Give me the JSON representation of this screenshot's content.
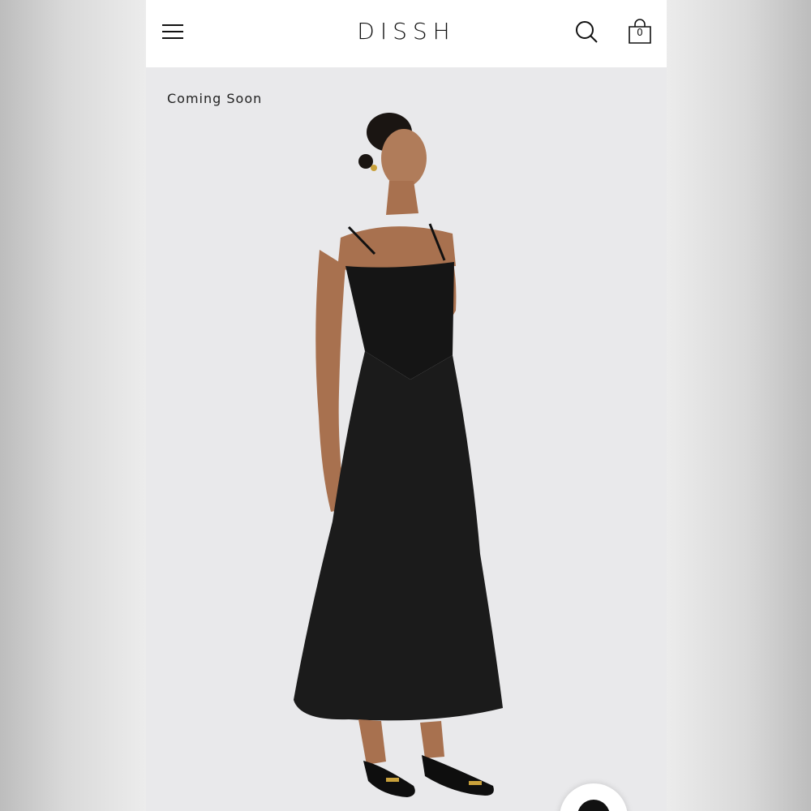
{
  "header": {
    "brand": "DISSH",
    "menu_icon": "hamburger-menu-icon",
    "search_icon": "search-icon",
    "cart_icon": "shopping-bag-icon",
    "cart_count": "0"
  },
  "product": {
    "badge": "Coming Soon",
    "image": "model-wearing-black-midi-dress"
  },
  "colors": {
    "header_bg": "#ffffff",
    "image_bg": "#e9e9eb",
    "text": "#111111"
  }
}
